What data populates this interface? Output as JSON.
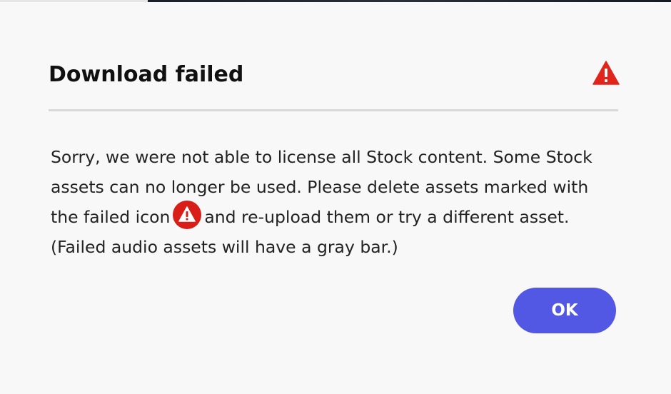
{
  "dialog": {
    "title": "Download failed",
    "header_icon": "alert-triangle-icon",
    "message": {
      "part1": "Sorry, we were not able to license all Stock content. Some Stock assets can no longer be used. Please delete assets marked with the failed icon",
      "inline_icon": "alert-circle-icon",
      "part2": "and re-upload them or try a different asset. (Failed audio assets will have a gray bar.)"
    },
    "ok_label": "OK"
  },
  "colors": {
    "background": "#f8f8f8",
    "title_text": "#111111",
    "body_text": "#222222",
    "divider": "#d9d9d9",
    "error_red": "#e1251b",
    "primary_button": "#5258e4",
    "button_text": "#ffffff"
  }
}
